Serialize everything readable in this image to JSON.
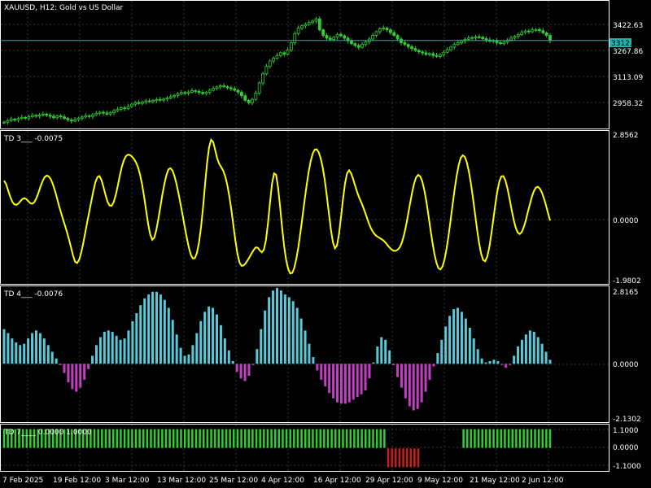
{
  "colors": {
    "background": "#000000",
    "frame": "#ffffff",
    "candle_up": "#32cd32",
    "bid_line": "#20b2aa",
    "td3_line": "#ffff00",
    "td4_positive": "#5ac8d8",
    "td4_negative": "#c040c0",
    "td7_positive": "#32cd32",
    "td7_negative": "#c81e1e"
  },
  "x_labels": [
    "7 Feb 2025",
    "19 Feb 12:00",
    "3 Mar 12:00",
    "13 Mar 12:00",
    "25 Mar 12:00",
    "4 Apr 12:00",
    "16 Apr 12:00",
    "29 Apr 12:00",
    "9 May 12:00",
    "21 May 12:00",
    "2 Jun 12:00"
  ],
  "chart_data": [
    {
      "type": "line",
      "title": "XAUUSD, H12:  Gold vs US Dollar",
      "subtype": "candlestick",
      "series": [
        {
          "values": [
            2866,
            2874,
            2882,
            2879,
            2886,
            2892,
            2888,
            2896,
            2903,
            2899,
            2905,
            2910,
            2904,
            2898,
            2890,
            2900,
            2895,
            2886,
            2878,
            2872,
            2880,
            2888,
            2894,
            2901,
            2897,
            2906,
            2914,
            2920,
            2916,
            2910,
            2918,
            2928,
            2936,
            2944,
            2940,
            2952,
            2964,
            2972,
            2968,
            2976,
            2982,
            2978,
            2984,
            2990,
            2986,
            2992,
            2998,
            3005,
            3012,
            3020,
            3028,
            3024,
            3030,
            3038,
            3034,
            3028,
            3022,
            3030,
            3040,
            3050,
            3058,
            3064,
            3060,
            3054,
            3048,
            3040,
            3030,
            3010,
            2985,
            2972,
            2990,
            3025,
            3080,
            3130,
            3170,
            3200,
            3215,
            3230,
            3245,
            3238,
            3260,
            3300,
            3350,
            3380,
            3392,
            3400,
            3410,
            3418,
            3430,
            3370,
            3340,
            3325,
            3318,
            3330,
            3345,
            3338,
            3325,
            3310,
            3295,
            3285,
            3275,
            3290,
            3305,
            3320,
            3340,
            3360,
            3375,
            3380,
            3370,
            3355,
            3340,
            3320,
            3300,
            3290,
            3278,
            3268,
            3258,
            3250,
            3244,
            3236,
            3240,
            3230,
            3225,
            3235,
            3248,
            3262,
            3276,
            3290,
            3300,
            3310,
            3318,
            3325,
            3328,
            3332,
            3330,
            3322,
            3315,
            3308,
            3312,
            3300,
            3295,
            3305,
            3315,
            3325,
            3335,
            3345,
            3356,
            3364,
            3360,
            3370,
            3372,
            3366,
            3354,
            3340,
            3312
          ]
        }
      ],
      "ytick_labels": [
        "3422.63",
        "3267.86",
        "3113.09",
        "2958.32"
      ],
      "ylim": [
        2840,
        3520
      ],
      "current_price": "3312.12"
    },
    {
      "type": "line",
      "title": "TD 3___ -0.0075",
      "series": [
        {
          "values": [
            1.31,
            1.2,
            0.99,
            0.79,
            0.63,
            0.54,
            0.52,
            0.56,
            0.64,
            0.71,
            0.74,
            0.71,
            0.64,
            0.57,
            0.56,
            0.62,
            0.75,
            0.93,
            1.13,
            1.3,
            1.43,
            1.48,
            1.45,
            1.36,
            1.2,
            0.99,
            0.76,
            0.51,
            0.28,
            0.06,
            -0.15,
            -0.37,
            -0.61,
            -0.87,
            -1.14,
            -1.34,
            -1.38,
            -1.27,
            -1.04,
            -0.73,
            -0.38,
            -0.03,
            0.31,
            0.65,
            0.98,
            1.26,
            1.43,
            1.46,
            1.33,
            1.1,
            0.84,
            0.62,
            0.5,
            0.49,
            0.61,
            0.84,
            1.14,
            1.47,
            1.76,
            1.98,
            2.11,
            2.16,
            2.15,
            2.1,
            2.02,
            1.91,
            1.75,
            1.51,
            1.19,
            0.79,
            0.33,
            -0.11,
            -0.45,
            -0.62,
            -0.55,
            -0.3,
            0.06,
            0.46,
            0.86,
            1.22,
            1.5,
            1.68,
            1.72,
            1.64,
            1.45,
            1.19,
            0.87,
            0.53,
            0.17,
            -0.2,
            -0.55,
            -0.87,
            -1.11,
            -1.23,
            -1.22,
            -1.05,
            -0.72,
            -0.22,
            0.43,
            1.17,
            1.87,
            2.4,
            2.65,
            2.58,
            2.32,
            2.04,
            1.86,
            1.75,
            1.63,
            1.44,
            1.16,
            0.79,
            0.34,
            -0.17,
            -0.67,
            -1.09,
            -1.37,
            -1.47,
            -1.46,
            -1.39,
            -1.29,
            -1.18,
            -1.06,
            -0.95,
            -0.87,
            -0.88,
            -0.97,
            -1.03,
            -0.94,
            -0.63,
            -0.08,
            0.6,
            1.21,
            1.55,
            1.5,
            1.09,
            0.46,
            -0.23,
            -0.84,
            -1.29,
            -1.58,
            -1.72,
            -1.7,
            -1.53,
            -1.24,
            -0.85,
            -0.38,
            0.13,
            0.65,
            1.14,
            1.58,
            1.94,
            2.19,
            2.32,
            2.34,
            2.24,
            2.04,
            1.74,
            1.33,
            0.82,
            0.26,
            -0.28,
            -0.7,
            -0.9,
            -0.81,
            -0.43,
            0.13,
            0.73,
            1.24,
            1.56,
            1.65,
            1.55,
            1.36,
            1.14,
            0.93,
            0.75,
            0.6,
            0.43,
            0.25,
            0.05,
            -0.13,
            -0.28,
            -0.39,
            -0.47,
            -0.52,
            -0.56,
            -0.6,
            -0.65,
            -0.72,
            -0.8,
            -0.88,
            -0.94,
            -0.98,
            -0.98,
            -0.94,
            -0.86,
            -0.71,
            -0.47,
            -0.17,
            0.19,
            0.56,
            0.92,
            1.22,
            1.42,
            1.5,
            1.45,
            1.29,
            1.02,
            0.66,
            0.22,
            -0.25,
            -0.69,
            -1.08,
            -1.37,
            -1.55,
            -1.59,
            -1.49,
            -1.26,
            -0.91,
            -0.47,
            0.03,
            0.55,
            1.05,
            1.49,
            1.83,
            2.06,
            2.14,
            2.09,
            1.91,
            1.61,
            1.22,
            0.75,
            0.24,
            -0.27,
            -0.72,
            -1.07,
            -1.28,
            -1.32,
            -1.18,
            -0.88,
            -0.45,
            0.04,
            0.53,
            0.96,
            1.28,
            1.45,
            1.46,
            1.32,
            1.06,
            0.73,
            0.38,
            0.05,
            -0.21,
            -0.38,
            -0.43,
            -0.37,
            -0.21,
            0.01,
            0.28,
            0.54,
            0.78,
            0.97,
            1.08,
            1.11,
            1.05,
            0.92,
            0.73,
            0.5,
            0.25,
            0.01
          ]
        }
      ],
      "ytick_labels": [
        "2.8562",
        "0.0000",
        "-1.9802"
      ],
      "ylim": [
        -1.9802,
        2.8562
      ]
    },
    {
      "type": "bar",
      "title": "TD 4___ -0.0076",
      "series": [
        {
          "values": [
            1.3,
            1.15,
            0.95,
            0.8,
            0.7,
            0.75,
            0.95,
            1.15,
            1.25,
            1.15,
            0.95,
            0.7,
            0.45,
            0.2,
            -0.05,
            -0.35,
            -0.7,
            -0.95,
            -1.05,
            -0.9,
            -0.6,
            -0.2,
            0.3,
            0.7,
            1.0,
            1.2,
            1.25,
            1.2,
            1.05,
            0.9,
            0.95,
            1.25,
            1.6,
            1.9,
            2.2,
            2.45,
            2.6,
            2.7,
            2.7,
            2.6,
            2.4,
            2.1,
            1.65,
            1.1,
            0.6,
            0.3,
            0.35,
            0.7,
            1.15,
            1.6,
            1.95,
            2.15,
            2.1,
            1.85,
            1.45,
            0.95,
            0.5,
            0.1,
            -0.3,
            -0.55,
            -0.65,
            -0.45,
            -0.05,
            0.55,
            1.3,
            2.0,
            2.5,
            2.75,
            2.85,
            2.75,
            2.6,
            2.5,
            2.35,
            2.1,
            1.7,
            1.25,
            0.75,
            0.25,
            -0.25,
            -0.6,
            -0.85,
            -1.1,
            -1.3,
            -1.45,
            -1.5,
            -1.5,
            -1.45,
            -1.35,
            -1.25,
            -1.15,
            -1.0,
            -0.55,
            0.05,
            0.65,
            1.0,
            0.9,
            0.5,
            -0.05,
            -0.5,
            -0.9,
            -1.3,
            -1.6,
            -1.75,
            -1.7,
            -1.45,
            -1.05,
            -0.6,
            -0.1,
            0.4,
            0.9,
            1.4,
            1.8,
            2.05,
            2.1,
            1.95,
            1.7,
            1.35,
            0.95,
            0.55,
            0.2,
            0.05,
            0.1,
            0.15,
            0.1,
            -0.05,
            -0.15,
            -0.05,
            0.3,
            0.65,
            0.9,
            1.1,
            1.25,
            1.2,
            1.0,
            0.75,
            0.45,
            0.15
          ]
        }
      ],
      "ytick_labels": [
        "2.8165",
        "0.0000",
        "-2.1302"
      ],
      "ylim": [
        -2.1302,
        2.8165
      ]
    },
    {
      "type": "bar",
      "title": "TD 7____ 0.0000  1.0000",
      "series": [
        {
          "values": [
            1,
            1,
            1,
            1,
            1,
            1,
            1,
            1,
            1,
            1,
            1,
            1,
            1,
            1,
            1,
            1,
            1,
            1,
            1,
            1,
            1,
            1,
            1,
            1,
            1,
            1,
            1,
            1,
            1,
            1,
            1,
            1,
            1,
            1,
            1,
            1,
            1,
            1,
            1,
            1,
            1,
            1,
            1,
            1,
            1,
            1,
            1,
            1,
            1,
            1,
            1,
            1,
            1,
            1,
            1,
            1,
            1,
            1,
            1,
            1,
            1,
            1,
            1,
            1,
            1,
            1,
            1,
            1,
            1,
            1,
            1,
            1,
            1,
            1,
            1,
            1,
            1,
            1,
            1,
            1,
            1,
            1,
            1,
            1,
            1,
            1,
            1,
            1,
            1,
            1,
            1,
            1,
            1,
            1,
            1,
            1,
            1,
            1,
            1,
            1,
            1,
            1,
            -1,
            -1,
            -1,
            -1,
            -1,
            -1,
            -1,
            -1,
            -1,
            0,
            0,
            0,
            0,
            0,
            0,
            0,
            0,
            0,
            0,
            0,
            1,
            1,
            1,
            1,
            1,
            1,
            1,
            1,
            1,
            1,
            1,
            1,
            1,
            1,
            1,
            1,
            1,
            1,
            1,
            1,
            1,
            1,
            1,
            1
          ]
        }
      ],
      "ytick_labels": [
        "1.1000",
        "0.0000",
        "-1.1000"
      ],
      "ylim": [
        -1.1,
        1.1
      ]
    }
  ]
}
